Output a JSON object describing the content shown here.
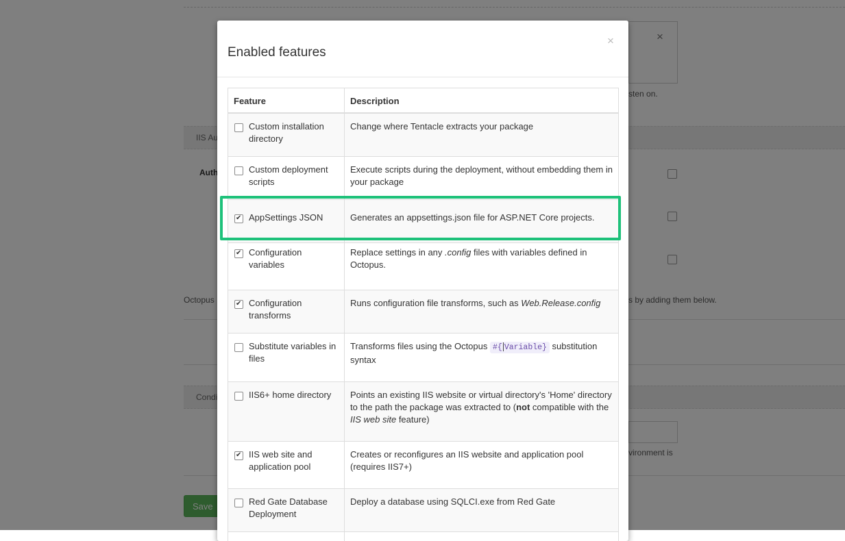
{
  "background": {
    "section1_label": "IIS Au",
    "section2_label": "Condi",
    "auth_label": "Auth",
    "listen_text": "sten on.",
    "octopus_text": "Octopus",
    "adding_text": "s by adding them below.",
    "environment_text": "vironment is",
    "save_label": "Save",
    "card_close": "×"
  },
  "modal": {
    "title": "Enabled features",
    "close": "×",
    "headers": {
      "feature": "Feature",
      "description": "Description"
    },
    "rows": [
      {
        "feature": "Custom installation directory",
        "checked": false,
        "description": "Change where Tentacle extracts your package"
      },
      {
        "feature": "Custom deployment scripts",
        "checked": false,
        "description": "Execute scripts during the deployment, without embedding them in your package"
      },
      {
        "feature": "AppSettings JSON",
        "checked": true,
        "description": "Generates an appsettings.json file for ASP.NET Core projects."
      },
      {
        "feature": "Configuration variables",
        "checked": true,
        "description_pre": "Replace settings in any ",
        "description_em": ".config",
        "description_post": " files with variables defined in Octopus."
      },
      {
        "feature": "Configuration transforms",
        "checked": true,
        "description_pre": "Runs configuration file transforms, such as ",
        "description_em": "Web.Release.config"
      },
      {
        "feature": "Substitute variables in files",
        "checked": false,
        "description_pre": "Transforms files using the Octopus ",
        "description_code_a": "#{",
        "description_code_b": "Variable}",
        "description_post": " substitution syntax"
      },
      {
        "feature": "IIS6+ home directory",
        "checked": false,
        "description_pre": "Points an existing IIS website or virtual directory's 'Home' directory to the path the package was extracted to (",
        "description_strong": "not",
        "description_mid": " compatible with the ",
        "description_em": "IIS web site",
        "description_post": " feature)"
      },
      {
        "feature": "IIS web site and application pool",
        "checked": true,
        "description": "Creates or reconfigures an IIS website and application pool (requires IIS7+)"
      },
      {
        "feature": "Red Gate Database Deployment",
        "checked": false,
        "description": "Deploy a database using SQLCI.exe from Red Gate"
      }
    ]
  },
  "colors": {
    "highlight": "#1ec17a",
    "save_button": "#5cb85c"
  }
}
